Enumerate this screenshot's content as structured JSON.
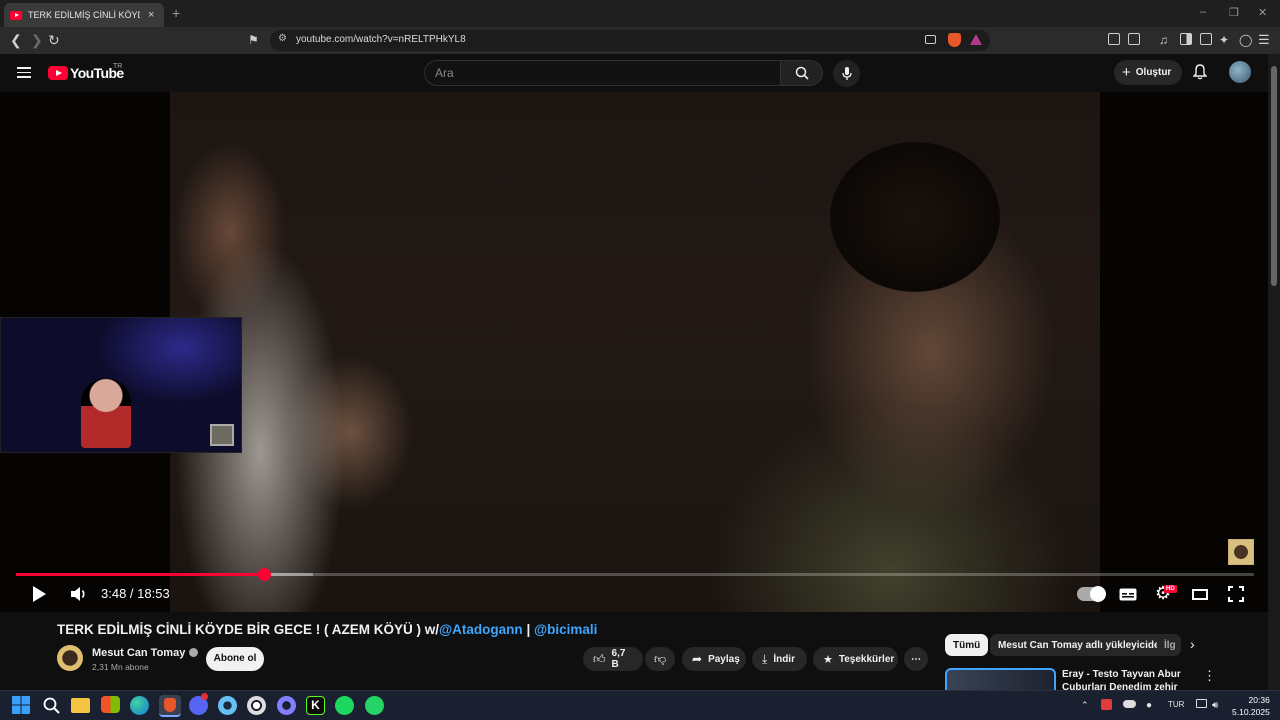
{
  "browser": {
    "tab_title": "TERK EDİLMİŞ CİNLİ KÖYDE BİR GECE ! ( AZEM KÖYÜ ) w/@Atadogann | @bicimali",
    "tab_close": "×",
    "new_tab": "+",
    "url": "youtube.com/watch?v=nRELTPHkYL8",
    "window_controls": [
      "–",
      "❐",
      "✕"
    ]
  },
  "youtube": {
    "logo_text": "YouTube",
    "country_code": "TR",
    "search_placeholder": "Ara",
    "create_label": "Oluştur"
  },
  "player": {
    "current_time": "3:48",
    "duration": "18:53",
    "time_display": "3:48 / 18:53",
    "progress_fraction": 0.201,
    "buffered_fraction": 0.24,
    "hd_badge": "HD"
  },
  "video": {
    "title_main": "TERK EDİLMİŞ CİNLİ KÖYDE BİR GECE ! ( AZEM KÖYÜ ) w/",
    "mention_1": "@Atadogann",
    "separator": " | ",
    "mention_2": "@bicimali",
    "channel_name": "Mesut Can Tomay",
    "subscribers": "2,31 Mn abone",
    "subscribe_label": "Abone ol",
    "likes": "6,7 B",
    "share_label": "Paylaş",
    "download_label": "İndir",
    "thanks_label": "Teşekkürler",
    "more_label": "⋯"
  },
  "recommendations": {
    "chips": [
      "Tümü",
      "Mesut Can Tomay adlı yükleyiciden",
      "İlg"
    ],
    "first_title": "Eray - Testo Tayvan Abur Cuburları Denedim zehir gibi",
    "menu": "⋮"
  },
  "taskbar": {
    "lang": "TUR",
    "time": "20:36",
    "date": "5.10.2025",
    "apps": [
      "windows-start",
      "search",
      "file-explorer",
      "store",
      "edge",
      "brave",
      "discord",
      "steam",
      "chrome",
      "obs",
      "kick",
      "spotify",
      "whatsapp"
    ]
  },
  "colors": {
    "accent_red": "#ff0033",
    "mention_blue": "#3ea6ff",
    "background": "#0f0f0f"
  }
}
